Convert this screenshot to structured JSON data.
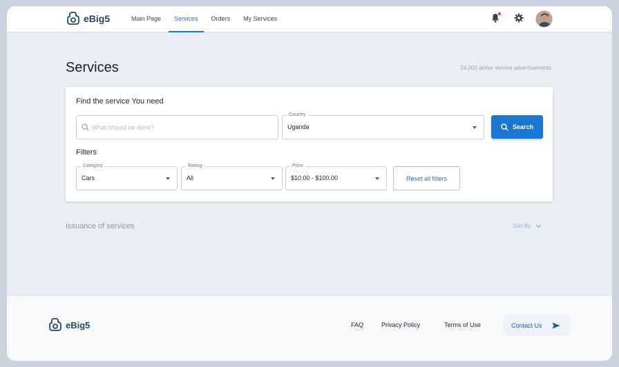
{
  "app": {
    "name": "eBig5"
  },
  "nav": {
    "items": [
      {
        "label": "Main Page",
        "active": false
      },
      {
        "label": "Services",
        "active": true
      },
      {
        "label": "Orders",
        "active": false
      },
      {
        "label": "My Services",
        "active": false
      }
    ]
  },
  "icons": {
    "notification": "bell-icon",
    "settings": "gear-icon",
    "search": "search-icon",
    "sort": "chevron-down-icon",
    "contact": "send-icon"
  },
  "colors": {
    "accent": "#1976d2",
    "brand": "#234b68",
    "notification_dot": "#e53935"
  },
  "page": {
    "title": "Services",
    "ad_count": "24,000 active service advertisements"
  },
  "search": {
    "heading": "Find the service You need",
    "placeholder": "What should be done?",
    "value": "",
    "country_label": "Country",
    "country_value": "Uganda",
    "button_label": "Search"
  },
  "filters": {
    "heading": "Filters",
    "category_label": "Category",
    "category_value": "Cars",
    "rating_label": "Rating",
    "rating_value": "All",
    "price_label": "Price",
    "price_value": "$10.00 - $100.00",
    "reset_label": "Reset all filters"
  },
  "issuance": {
    "title": "Issuance of services",
    "sort_label": "Sort By"
  },
  "footer": {
    "links": [
      "FAQ",
      "Privacy Policy",
      "Terms of Use"
    ],
    "contact_label": "Contact Us"
  }
}
